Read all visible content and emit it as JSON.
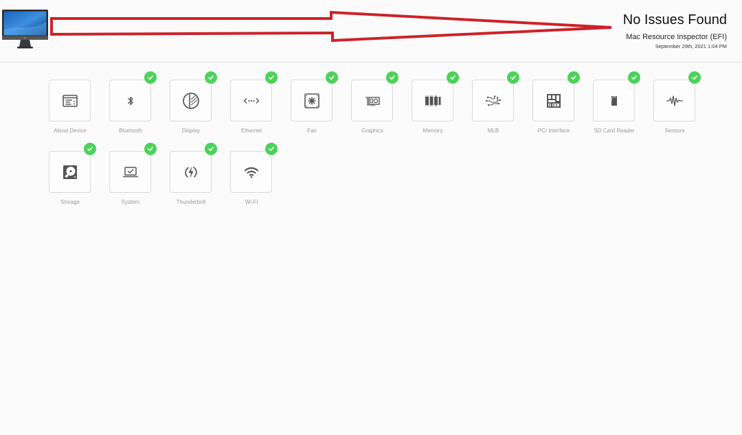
{
  "header": {
    "status_title": "No Issues Found",
    "app_name": "Mac Resource Inspector (EFI)",
    "timestamp": "September 29th, 2021 1:04 PM"
  },
  "colors": {
    "check_green": "#4cd25a",
    "annotation_red": "#cc2229",
    "icon_gray": "#555555",
    "label_gray": "#9a9a9a"
  },
  "tiles": [
    {
      "label": "About Device",
      "icon": "about-device-icon",
      "checked": false
    },
    {
      "label": "Bluetooth",
      "icon": "bluetooth-icon",
      "checked": true
    },
    {
      "label": "Display",
      "icon": "display-icon",
      "checked": true
    },
    {
      "label": "Ethernet",
      "icon": "ethernet-icon",
      "checked": true
    },
    {
      "label": "Fan",
      "icon": "fan-icon",
      "checked": true
    },
    {
      "label": "Graphics",
      "icon": "graphics-card-icon",
      "checked": true
    },
    {
      "label": "Memory",
      "icon": "memory-icon",
      "checked": true
    },
    {
      "label": "MLB",
      "icon": "logic-board-icon",
      "checked": true
    },
    {
      "label": "PCI Interface",
      "icon": "pci-interface-icon",
      "checked": true
    },
    {
      "label": "SD Card Reader",
      "icon": "sd-card-icon",
      "checked": true
    },
    {
      "label": "Sensors",
      "icon": "sensors-icon",
      "checked": true
    },
    {
      "label": "Storage",
      "icon": "storage-icon",
      "checked": true
    },
    {
      "label": "System",
      "icon": "system-laptop-icon",
      "checked": true
    },
    {
      "label": "Thunderbolt",
      "icon": "thunderbolt-icon",
      "checked": true
    },
    {
      "label": "Wi-Fi",
      "icon": "wifi-icon",
      "checked": true
    }
  ]
}
